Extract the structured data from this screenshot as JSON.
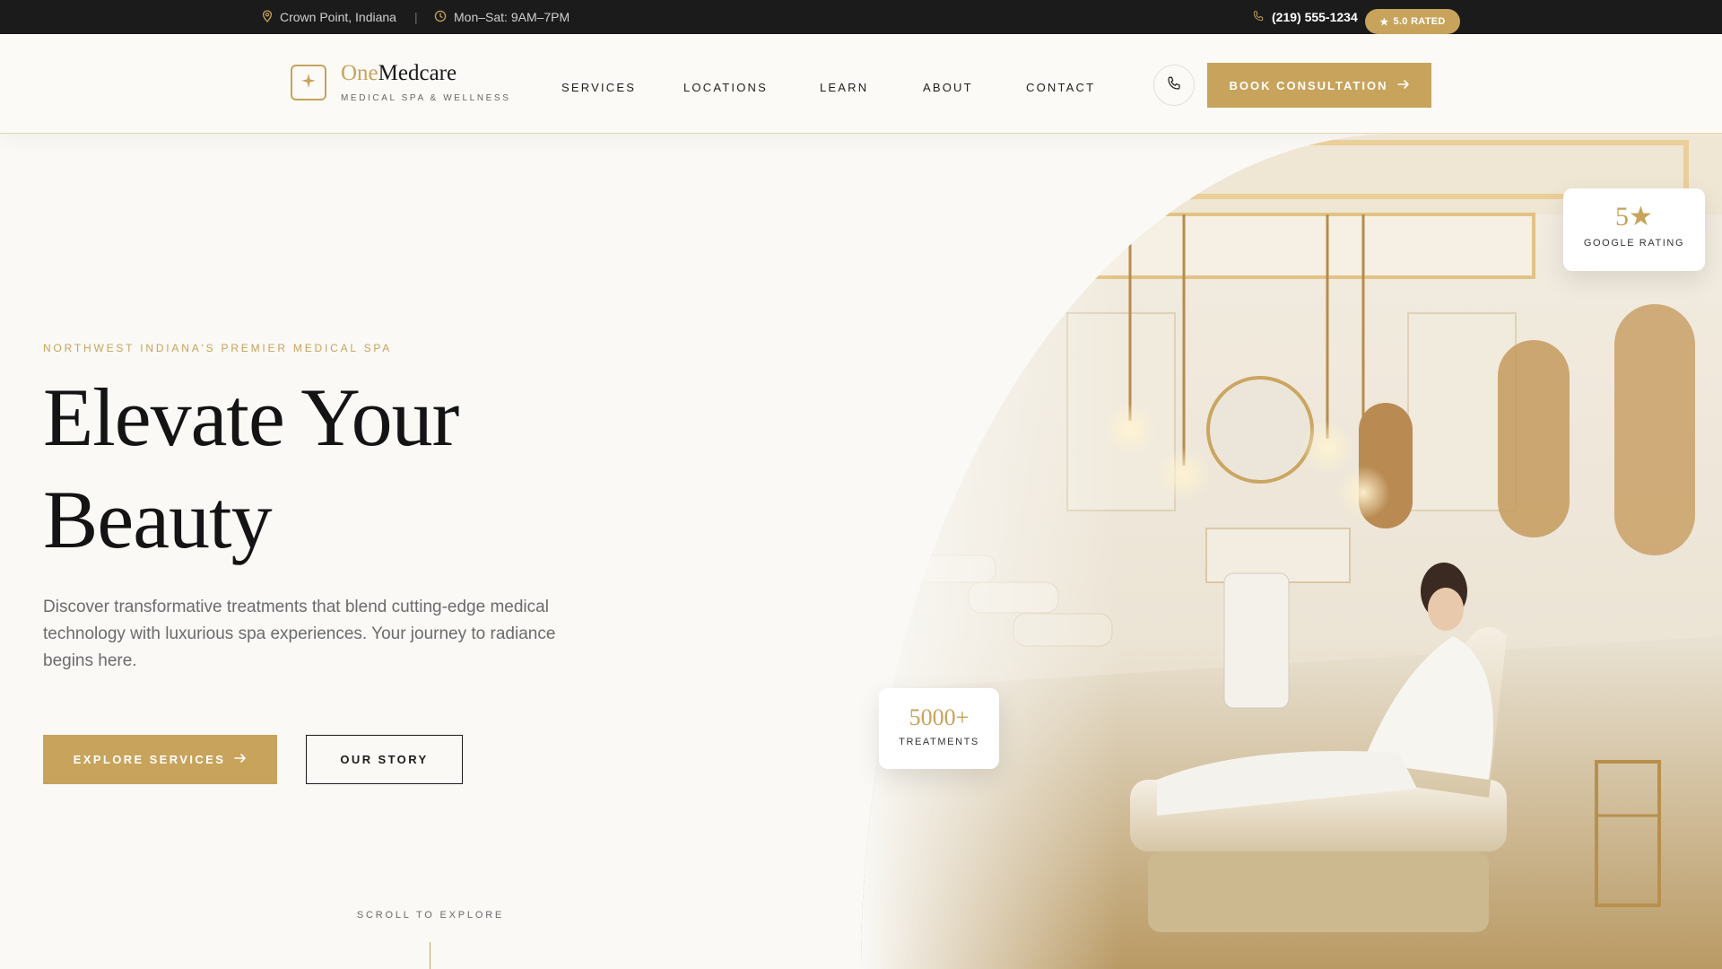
{
  "topbar": {
    "location": "Crown Point, Indiana",
    "separator": "|",
    "hours": "Mon–Sat: 9AM–7PM",
    "phone": "(219) 555-1234",
    "rated_badge": "5.0 RATED"
  },
  "brand": {
    "name_part1": "One",
    "name_part2": "Medcare",
    "tagline": "MEDICAL SPA & WELLNESS",
    "logo_icon": "sparkle-icon"
  },
  "nav": {
    "items": [
      {
        "label": "SERVICES"
      },
      {
        "label": "LOCATIONS"
      },
      {
        "label": "LEARN"
      },
      {
        "label": "ABOUT"
      },
      {
        "label": "CONTACT"
      }
    ],
    "call_icon": "phone-icon",
    "cta_label": "BOOK CONSULTATION"
  },
  "hero": {
    "eyebrow": "NORTHWEST INDIANA'S PREMIER MEDICAL SPA",
    "title_line1": "Elevate Your",
    "title_line2": "Beauty",
    "description": "Discover transformative treatments that blend cutting-edge medical technology with luxurious spa experiences. Your journey to radiance begins here.",
    "primary_button": "EXPLORE SERVICES",
    "secondary_button": "OUR STORY",
    "scroll_label": "SCROLL TO EXPLORE"
  },
  "cards": {
    "rating": {
      "value": "5★",
      "label": "GOOGLE RATING"
    },
    "treatments": {
      "value": "5000+",
      "label": "TREATMENTS"
    }
  },
  "colors": {
    "accent_gold": "#c7a35b",
    "topbar_bg": "#1b1b1b",
    "page_bg": "#faf9f6",
    "text_dark": "#1b1b1b"
  }
}
